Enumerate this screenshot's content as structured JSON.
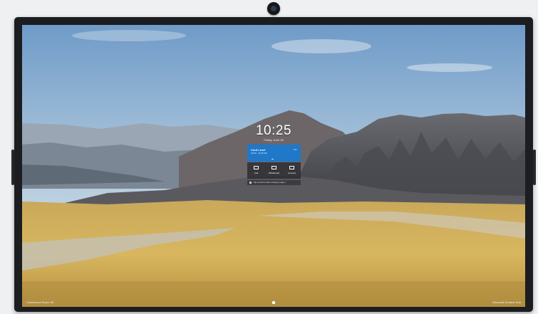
{
  "lockscreen": {
    "time": "10:25",
    "date": "Friday, June 18",
    "meeting": {
      "title": "Conf Level",
      "time": "10:00 - 11:00 AM",
      "join_label": "Join"
    },
    "actions": [
      {
        "label": "Call",
        "icon": "phone-video-icon"
      },
      {
        "label": "Whiteboard",
        "icon": "whiteboard-icon"
      },
      {
        "label": "Connect",
        "icon": "screen-connect-icon"
      }
    ],
    "notice": "Tap or touch to start a meeting or sign in"
  },
  "taskbar": {
    "room_name": "Conference Room 4E",
    "brand": "Microsoft Surface Hub"
  }
}
